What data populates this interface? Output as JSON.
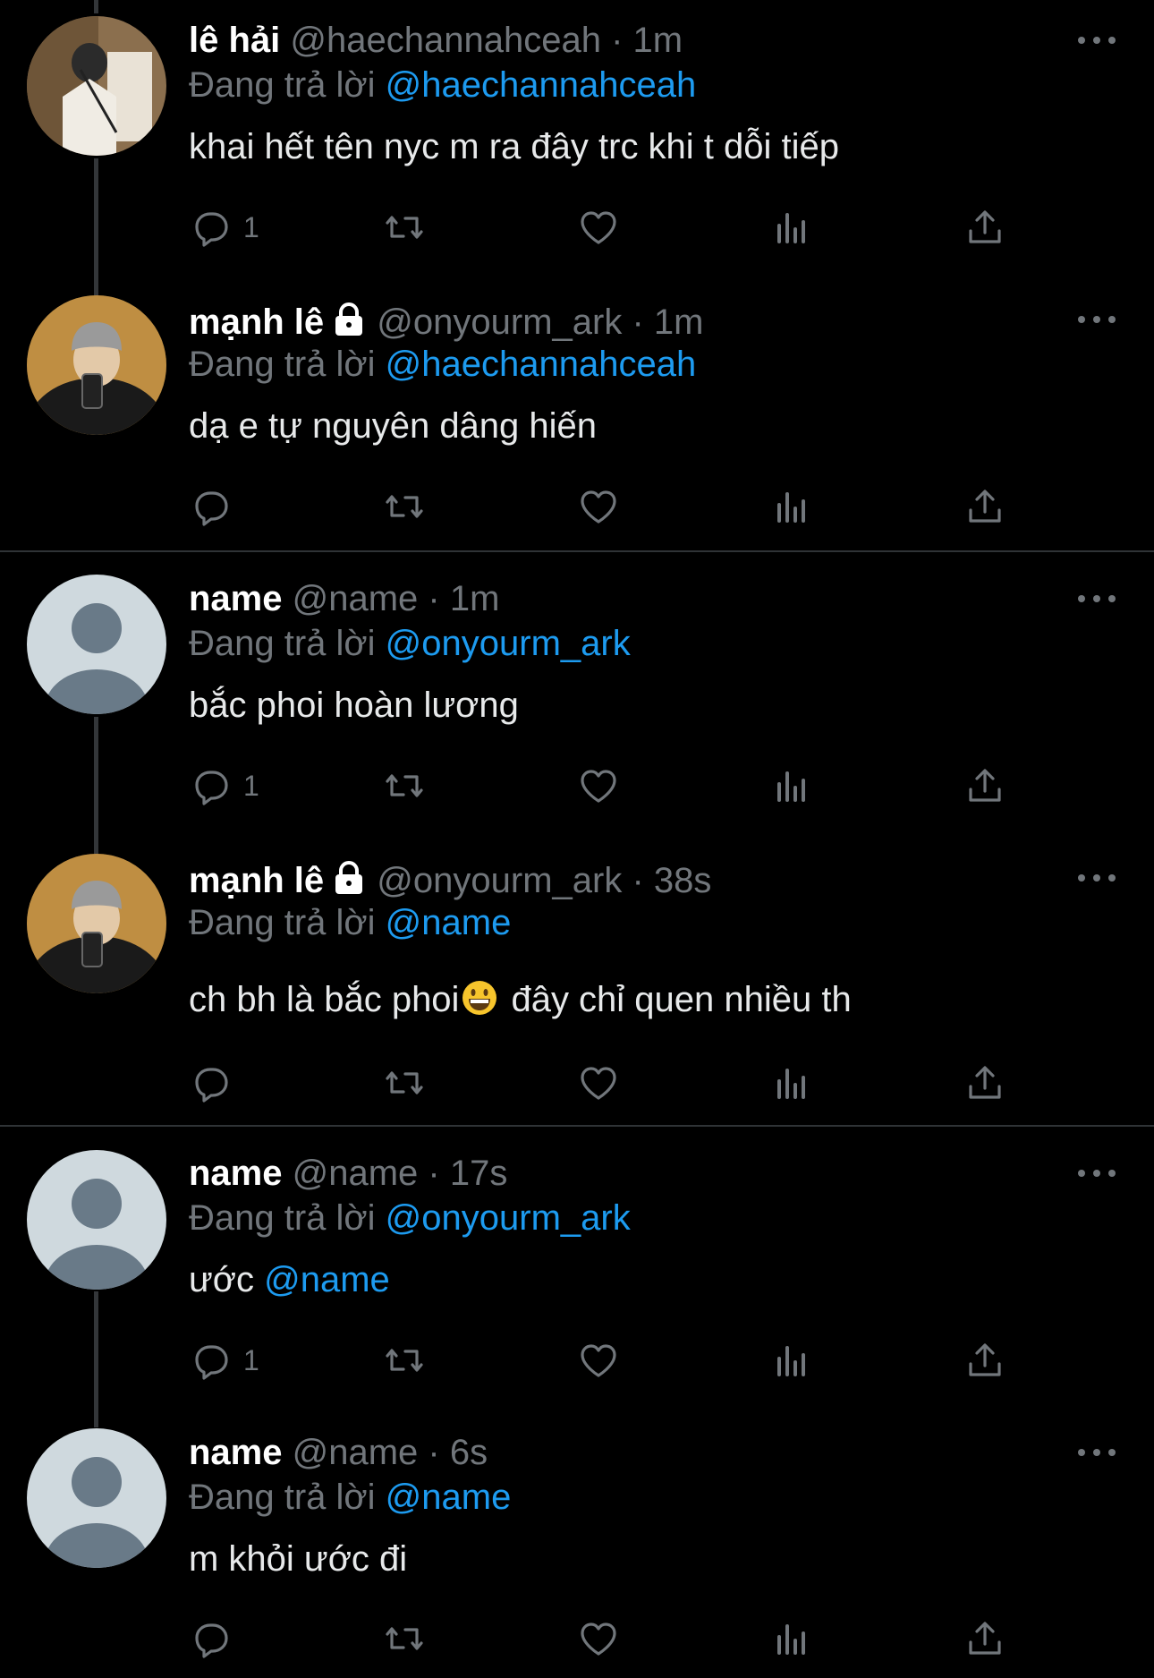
{
  "replying_label": "Đang trả lời",
  "tweets": [
    {
      "name": "lê hải",
      "handle": "@haechannahceah",
      "separator": "·",
      "time": "1m",
      "replying_to": "@haechannahceah",
      "text": "khai hết tên nyc m ra đây trc khi t dỗi tiếp",
      "reply_count": "1",
      "avatar": "photo-mirror-selfie"
    },
    {
      "name": "mạnh lê",
      "locked": true,
      "handle": "@onyourm_ark",
      "separator": "·",
      "time": "1m",
      "replying_to": "@haechannahceah",
      "text": "dạ e tự nguyên dâng hiến",
      "reply_count": "",
      "avatar": "photo-beanie-selfie"
    },
    {
      "name": "name",
      "handle": "@name",
      "separator": "·",
      "time": "1m",
      "replying_to": "@onyourm_ark",
      "text": "bắc phoi hoàn lương",
      "reply_count": "1",
      "avatar": "default-avatar"
    },
    {
      "name": "mạnh lê",
      "locked": true,
      "handle": "@onyourm_ark",
      "separator": "·",
      "time": "38s",
      "replying_to": "@name",
      "text_before_emoji": "ch bh là bắc phoi",
      "text_after_emoji": "đây chỉ quen nhiều th",
      "reply_count": "",
      "avatar": "photo-beanie-selfie"
    },
    {
      "name": "name",
      "handle": "@name",
      "separator": "·",
      "time": "17s",
      "replying_to": "@onyourm_ark",
      "text": "ước",
      "text_mention": "@name",
      "reply_count": "1",
      "avatar": "default-avatar"
    },
    {
      "name": "name",
      "handle": "@name",
      "separator": "·",
      "time": "6s",
      "replying_to": "@name",
      "text": "m khỏi ước đi",
      "reply_count": "",
      "avatar": "default-avatar"
    }
  ],
  "icons": [
    "reply-icon",
    "retweet-icon",
    "like-icon",
    "views-icon",
    "share-icon",
    "more-icon",
    "lock-icon"
  ],
  "colors": {
    "background": "#000000",
    "text": "#e7e9ea",
    "muted": "#71767b",
    "accent": "#1d9bf0",
    "divider": "#2f3336"
  }
}
